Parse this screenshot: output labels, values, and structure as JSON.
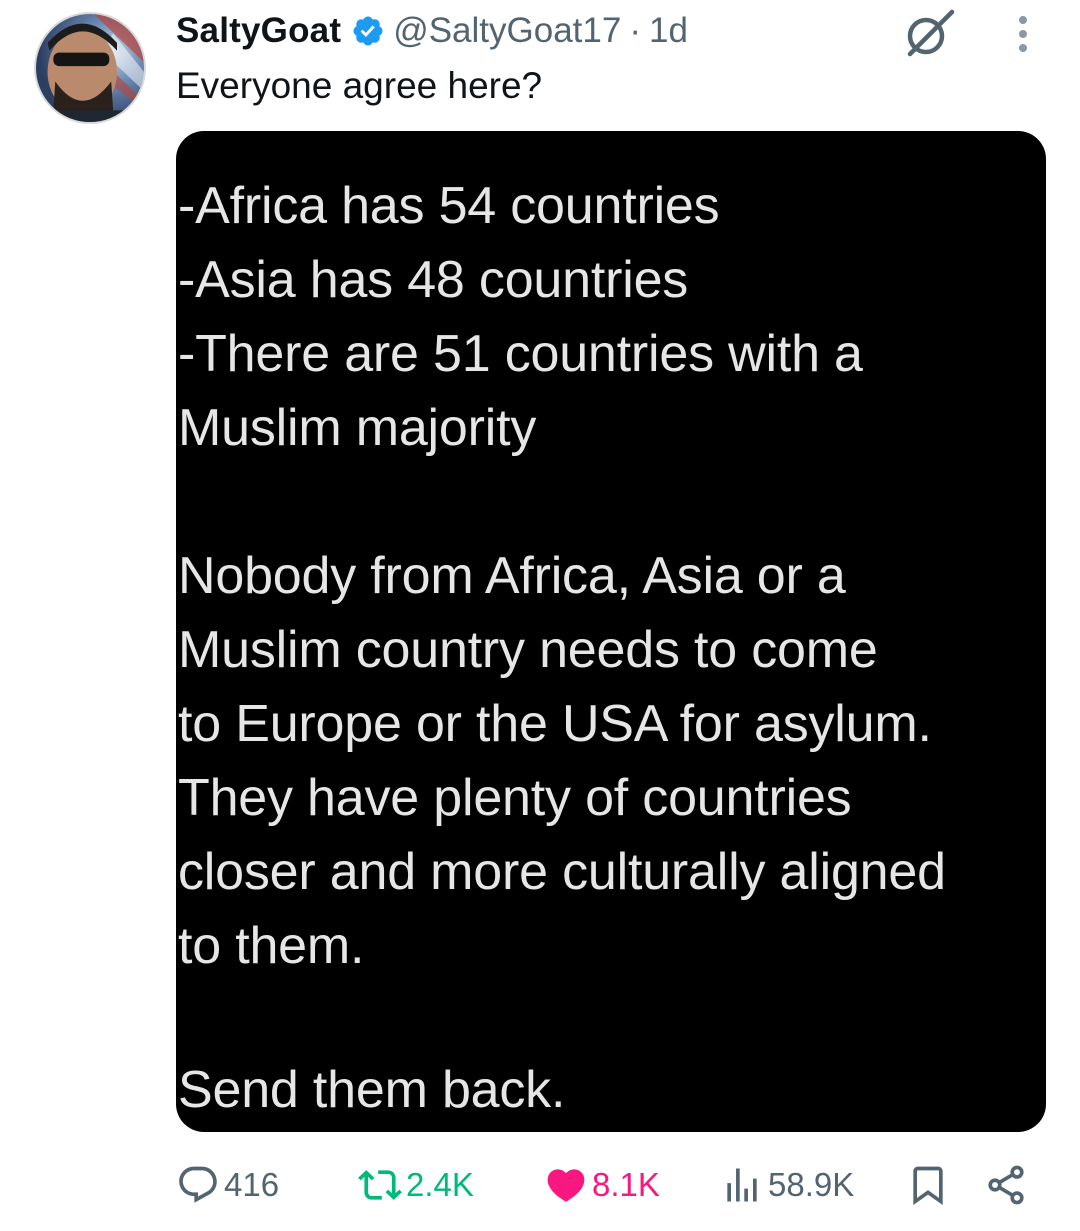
{
  "author": {
    "display_name": "SaltyGoat",
    "handle": "@SaltyGoat17",
    "separator": "·",
    "time": "1d",
    "verified": true
  },
  "tweet": {
    "text": "Everyone agree here?"
  },
  "media": {
    "lines_group1": [
      "-Africa has 54 countries",
      "-Asia has 48 countries",
      "-There are 51 countries with a",
      "Muslim majority"
    ],
    "lines_group2": [
      "Nobody from Africa, Asia or a",
      "Muslim country needs to come",
      "to Europe or the USA for asylum.",
      "They have plenty of countries",
      "closer and more culturally aligned",
      "to them."
    ],
    "lines_group3": [
      "Send them back."
    ]
  },
  "actions": {
    "replies": "416",
    "reposts": "2.4K",
    "likes": "8.1K",
    "views": "58.9K"
  },
  "icons": {
    "verified": "verified-badge-icon",
    "grok": "grok-icon",
    "more": "more-icon",
    "reply": "reply-icon",
    "repost": "repost-icon",
    "like": "heart-icon",
    "views": "views-icon",
    "bookmark": "bookmark-icon",
    "share": "share-icon"
  },
  "colors": {
    "verified": "#1d9bf0",
    "repost_active": "#00ba7c",
    "like_active": "#f91880",
    "secondary_text": "#536471"
  }
}
